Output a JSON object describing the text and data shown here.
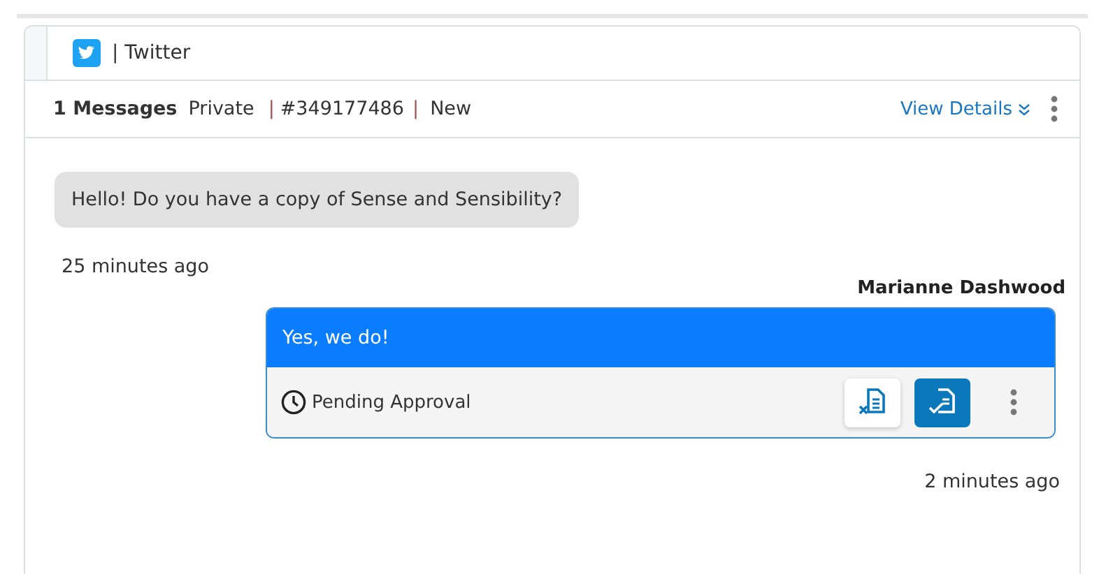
{
  "channel": {
    "label": "| Twitter"
  },
  "header": {
    "count": "1 Messages",
    "privacy": "Private",
    "ticket_separator": "|",
    "ticket": "#349177486",
    "status_separator": "|",
    "status": "New",
    "link": "View Details"
  },
  "messages": [
    {
      "kind": "incoming",
      "text": "Hello! Do you have a copy of Sense and Sensibility?",
      "time": "25 minutes ago"
    },
    {
      "kind": "outgoing",
      "author": "Marianne Dashwood",
      "text": "Yes, we do!",
      "status": "Pending Approval",
      "time": "2 minutes ago"
    }
  ]
}
